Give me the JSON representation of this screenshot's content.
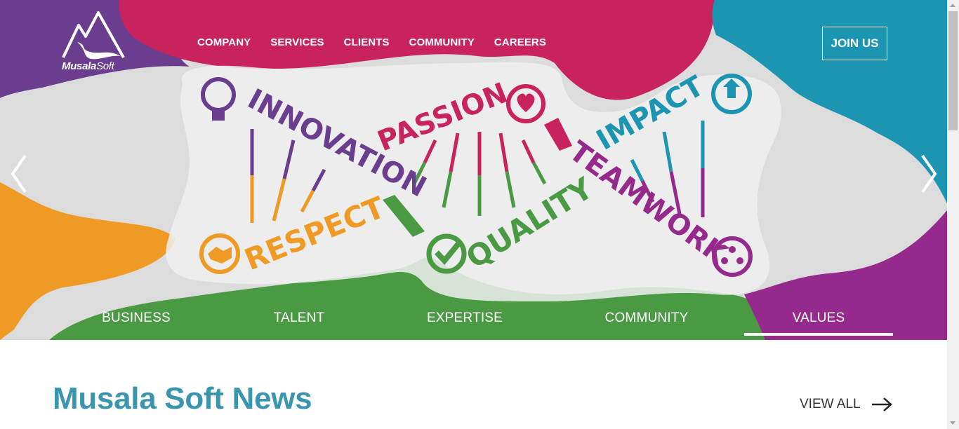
{
  "brand": {
    "name_bold": "Musala",
    "name_thin": "Soft"
  },
  "nav": {
    "items": [
      {
        "label": "COMPANY"
      },
      {
        "label": "SERVICES"
      },
      {
        "label": "CLIENTS"
      },
      {
        "label": "COMMUNITY"
      },
      {
        "label": "CAREERS"
      }
    ],
    "join_label": "JOIN US"
  },
  "hero": {
    "values": {
      "innovation": "INNOVATION",
      "passion": "PASSION",
      "impact": "IMPACT",
      "respect": "RESPECT",
      "quality": "QUALITY",
      "teamwork": "TEAMWORK"
    },
    "colors": {
      "purple": "#6a3d8e",
      "magenta": "#c8235f",
      "teal": "#1c95b3",
      "orange": "#ef9a24",
      "green": "#4a9a44",
      "violet": "#962a8c"
    }
  },
  "tabs": {
    "items": [
      {
        "label": "BUSINESS"
      },
      {
        "label": "TALENT"
      },
      {
        "label": "EXPERTISE"
      },
      {
        "label": "COMMUNITY"
      },
      {
        "label": "VALUES"
      }
    ],
    "active": "VALUES"
  },
  "news": {
    "title": "Musala Soft News",
    "view_all": "VIEW ALL"
  }
}
